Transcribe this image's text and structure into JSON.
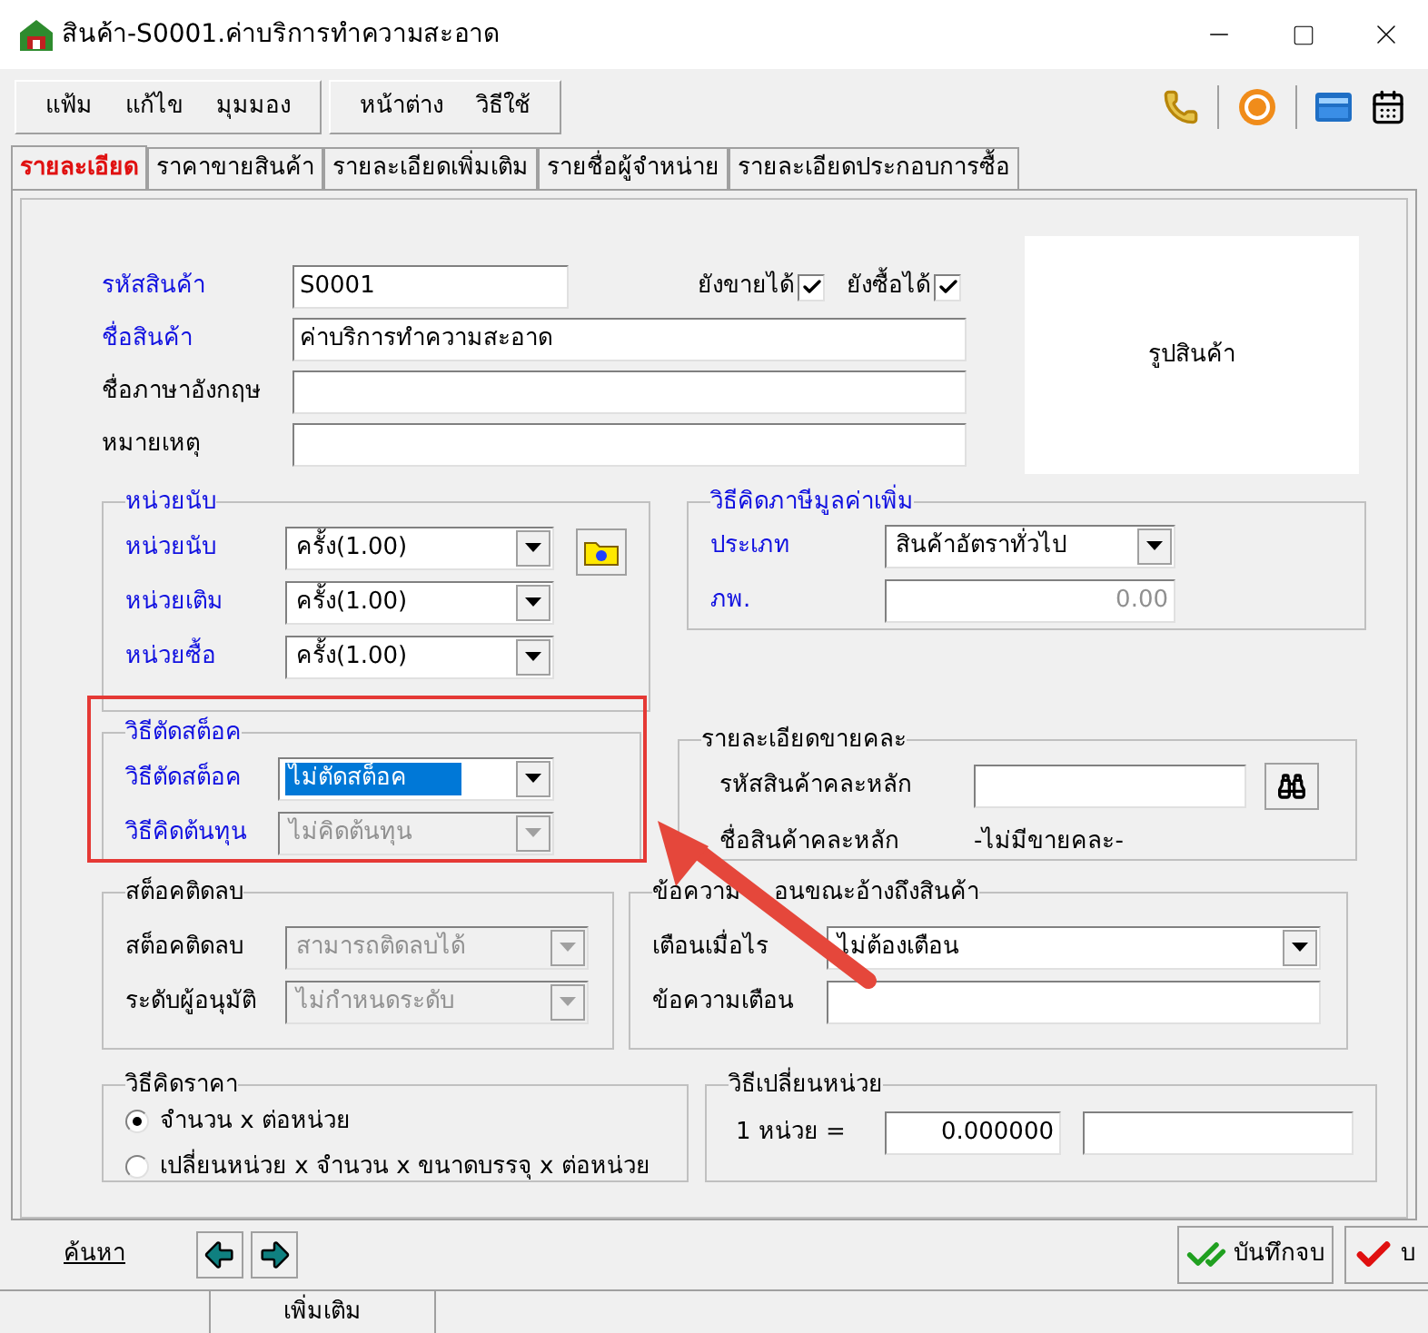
{
  "window": {
    "title": "สินค้า-S0001.ค่าบริการทำความสะอาด"
  },
  "menu": [
    {
      "items": [
        "แฟ้ม",
        "แก้ไข",
        "มุมมอง"
      ]
    },
    {
      "items": [
        "หน้าต่าง",
        "วิธีใช้"
      ]
    }
  ],
  "tabs": [
    {
      "label": "รายละเอียด",
      "selected": true
    },
    {
      "label": "ราคาขายสินค้า",
      "selected": false
    },
    {
      "label": "รายละเอียดเพิ่มเติม",
      "selected": false
    },
    {
      "label": "รายชื่อผู้จำหน่าย",
      "selected": false
    },
    {
      "label": "รายละเอียดประกอบการซื้อ",
      "selected": false
    }
  ],
  "product": {
    "fields": [
      {
        "label": "รหัสสินค้า",
        "value": "S0001",
        "required": true,
        "kind": "short"
      },
      {
        "label": "ชื่อสินค้า",
        "value": "ค่าบริการทำความสะอาด",
        "required": true,
        "kind": "long"
      },
      {
        "label": "ชื่อภาษาอังกฤษ",
        "required": false,
        "kind": "long"
      },
      {
        "label": "หมายเหตุ",
        "required": false,
        "kind": "long"
      }
    ],
    "flags": [
      {
        "label": "ยังขายได้",
        "checked": true
      },
      {
        "label": "ยังซื้อได้",
        "checked": true
      }
    ],
    "image_label": "รูปสินค้า"
  },
  "units": {
    "title": "หน่วยนับ",
    "rows": [
      {
        "label": "หน่วยนับ",
        "value": "ครั้ง(1.00)"
      },
      {
        "label": "หน่วยเติม",
        "value": "ครั้ง(1.00)"
      },
      {
        "label": "หน่วยซื้อ",
        "value": "ครั้ง(1.00)"
      }
    ]
  },
  "vat": {
    "title": "วิธีคิดภาษีมูลค่าเพิ่ม",
    "type": {
      "label": "ประเภท",
      "value": "สินค้าอัตราทั่วไป"
    },
    "rate": {
      "label": "ภพ.",
      "value": "0.00"
    }
  },
  "stock_cut": {
    "title": "วิธีตัดสต็อค",
    "rows": [
      {
        "label": "วิธีตัดสต็อค",
        "value": "ไม่ตัดสต็อค",
        "focused": true,
        "disabled": false
      },
      {
        "label": "วิธีคิดต้นทุน",
        "value": "ไม่คิดต้นทุน",
        "focused": false,
        "disabled": true
      }
    ]
  },
  "mixed": {
    "title": "รายละเอียดขายคละ",
    "code_label": "รหัสสินค้าคละหลัก",
    "name_label": "ชื่อสินค้าคละหลัก",
    "name_value": "-ไม่มีขายคละ-"
  },
  "negative": {
    "title": "สต็อคติดลบ",
    "rows": [
      {
        "label": "สต็อคติดลบ",
        "value": "สามารถติดลบได้",
        "disabled": true
      },
      {
        "label": "ระดับผู้อนุมัติ",
        "value": "ไม่กำหนดระดับ",
        "disabled": true
      }
    ]
  },
  "warning": {
    "title_parts": [
      "ข้อความ",
      "อนขณะอ้างถึงสินค้า"
    ],
    "when": {
      "label": "เตือนเมื่อไร",
      "value": "ไม่ต้องเตือน"
    },
    "message_label": "ข้อความเตือน"
  },
  "pricing": {
    "title": "วิธีคิดราคา",
    "options": [
      {
        "label": "จำนวน x ต่อหน่วย",
        "selected": true
      },
      {
        "label": "เปลี่ยนหน่วย x จำนวน x ขนาดบรรจุ x ต่อหน่วย",
        "selected": false
      }
    ]
  },
  "conversion": {
    "title": "วิธีเปลี่ยนหน่วย",
    "label": "1 หน่วย =",
    "value": "0.000000"
  },
  "footer": {
    "search": "ค้นหา",
    "buttons": [
      {
        "label": "บันทึกจบ",
        "kind": "save"
      },
      {
        "label": "บ",
        "kind": "ok"
      }
    ]
  },
  "status_bar": {
    "text": "เพิ่มเติม"
  }
}
